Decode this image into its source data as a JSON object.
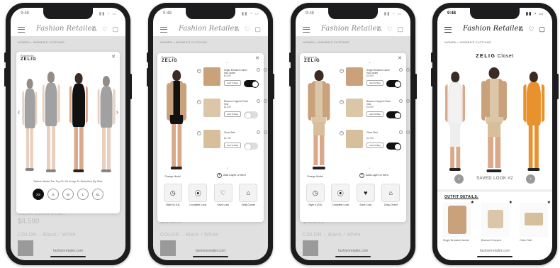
{
  "status": {
    "time": "9:48",
    "icons": "▮▮ ◔ ▭"
  },
  "header": {
    "logo": "Fashion Retailer",
    "icons": "♙ ♡ ▢"
  },
  "breadcrumb": "WOMEN > WOMEN'S CLOTHING",
  "product": {
    "title_faded": "COLLAR BLAZER JACKET",
    "price": "$4.590",
    "color": "COLOR – Black / White"
  },
  "url": "fashionretailer.com",
  "zelig": {
    "powered": "Powered by",
    "brand": "ZELIG",
    "close": "✕"
  },
  "size_modal": {
    "caption": "Select Model For Try On Or Jump To Selection By Size",
    "sizes": [
      "XS",
      "S",
      "M",
      "L",
      "XL"
    ],
    "selected": "XS",
    "prev": "‹",
    "next": "›"
  },
  "garments": [
    {
      "name": "Single Breasted Camel Hair Jacket",
      "price": "$2,090",
      "add": "Add To Bag",
      "on_screen2": true,
      "on_screen3": true
    },
    {
      "name": "Blouson Cropped Chore Vest",
      "price": "$1,090",
      "add": "Add To Bag",
      "on_screen2": false,
      "on_screen3": true
    },
    {
      "name": "Chino Skirt",
      "price": "$1,790",
      "add": "Add To Bag",
      "on_screen2": false,
      "on_screen3": true
    }
  ],
  "try_on": {
    "change_model": "Change Model",
    "add_layer": "Add Layer or Item",
    "actions": [
      {
        "icon": "◷",
        "label": "Style It (1/3)",
        "label2": "Style It (2/3)"
      },
      {
        "icon": "⦿",
        "label": "Complete Look"
      },
      {
        "icon": "♡",
        "icon_filled": "♥",
        "label": "Save Look"
      },
      {
        "icon": "⌂",
        "label": "Zelig Closet"
      }
    ]
  },
  "closet": {
    "title_brand": "ZELIG",
    "title_word": "Closet",
    "saved_label": "SAVED LOOK #2",
    "prev": "‹",
    "next": "›",
    "outfit_label": "OUTFIT DETAILS:",
    "products": [
      {
        "name": "Single Breasted Jacket",
        "star": "★"
      },
      {
        "name": "Blouson Cropped",
        "star": "★"
      },
      {
        "name": "Chino Skirt",
        "star": "★"
      }
    ]
  },
  "colors": {
    "accent": "#111111",
    "camel": "#c9a27c",
    "dim": "#999999"
  }
}
